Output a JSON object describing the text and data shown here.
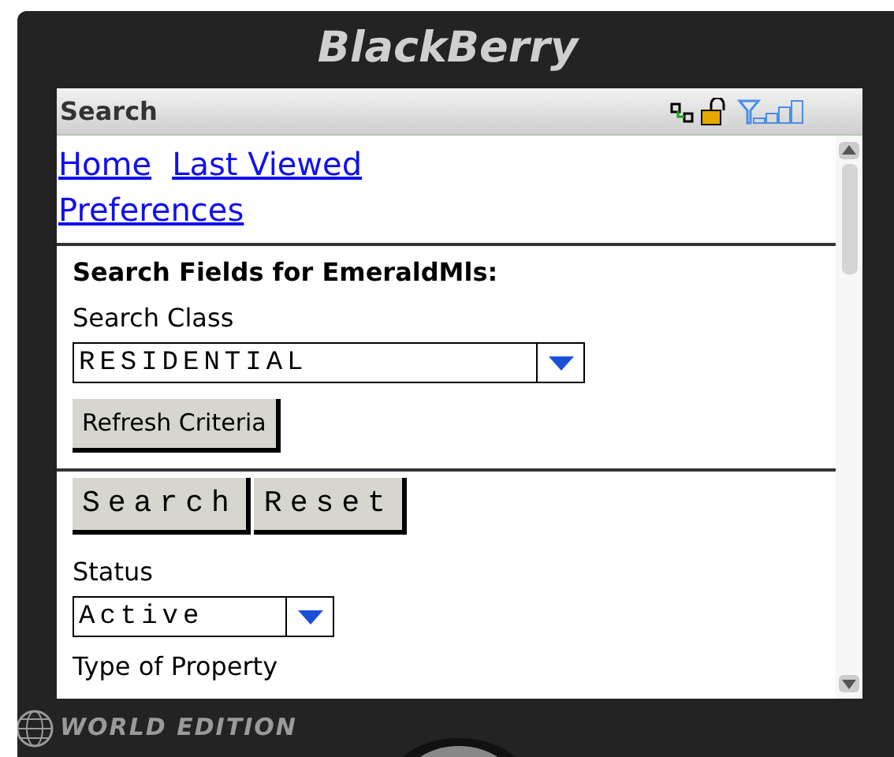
{
  "device": {
    "brand": "BlackBerry",
    "edition": "WORLD EDITION"
  },
  "title_bar": {
    "title": "Search"
  },
  "links": [
    {
      "label": "Home"
    },
    {
      "label": "Last Viewed"
    },
    {
      "label": "Preferences"
    }
  ],
  "heading": "Search Fields for EmeraldMls:",
  "search_class": {
    "label": "Search Class",
    "value": "RESIDENTIAL"
  },
  "refresh_button": "Refresh Criteria",
  "buttons": [
    "Search",
    "Reset"
  ],
  "status": {
    "label": "Status",
    "value": "Active"
  },
  "next_field": {
    "label": "Type of Property"
  }
}
